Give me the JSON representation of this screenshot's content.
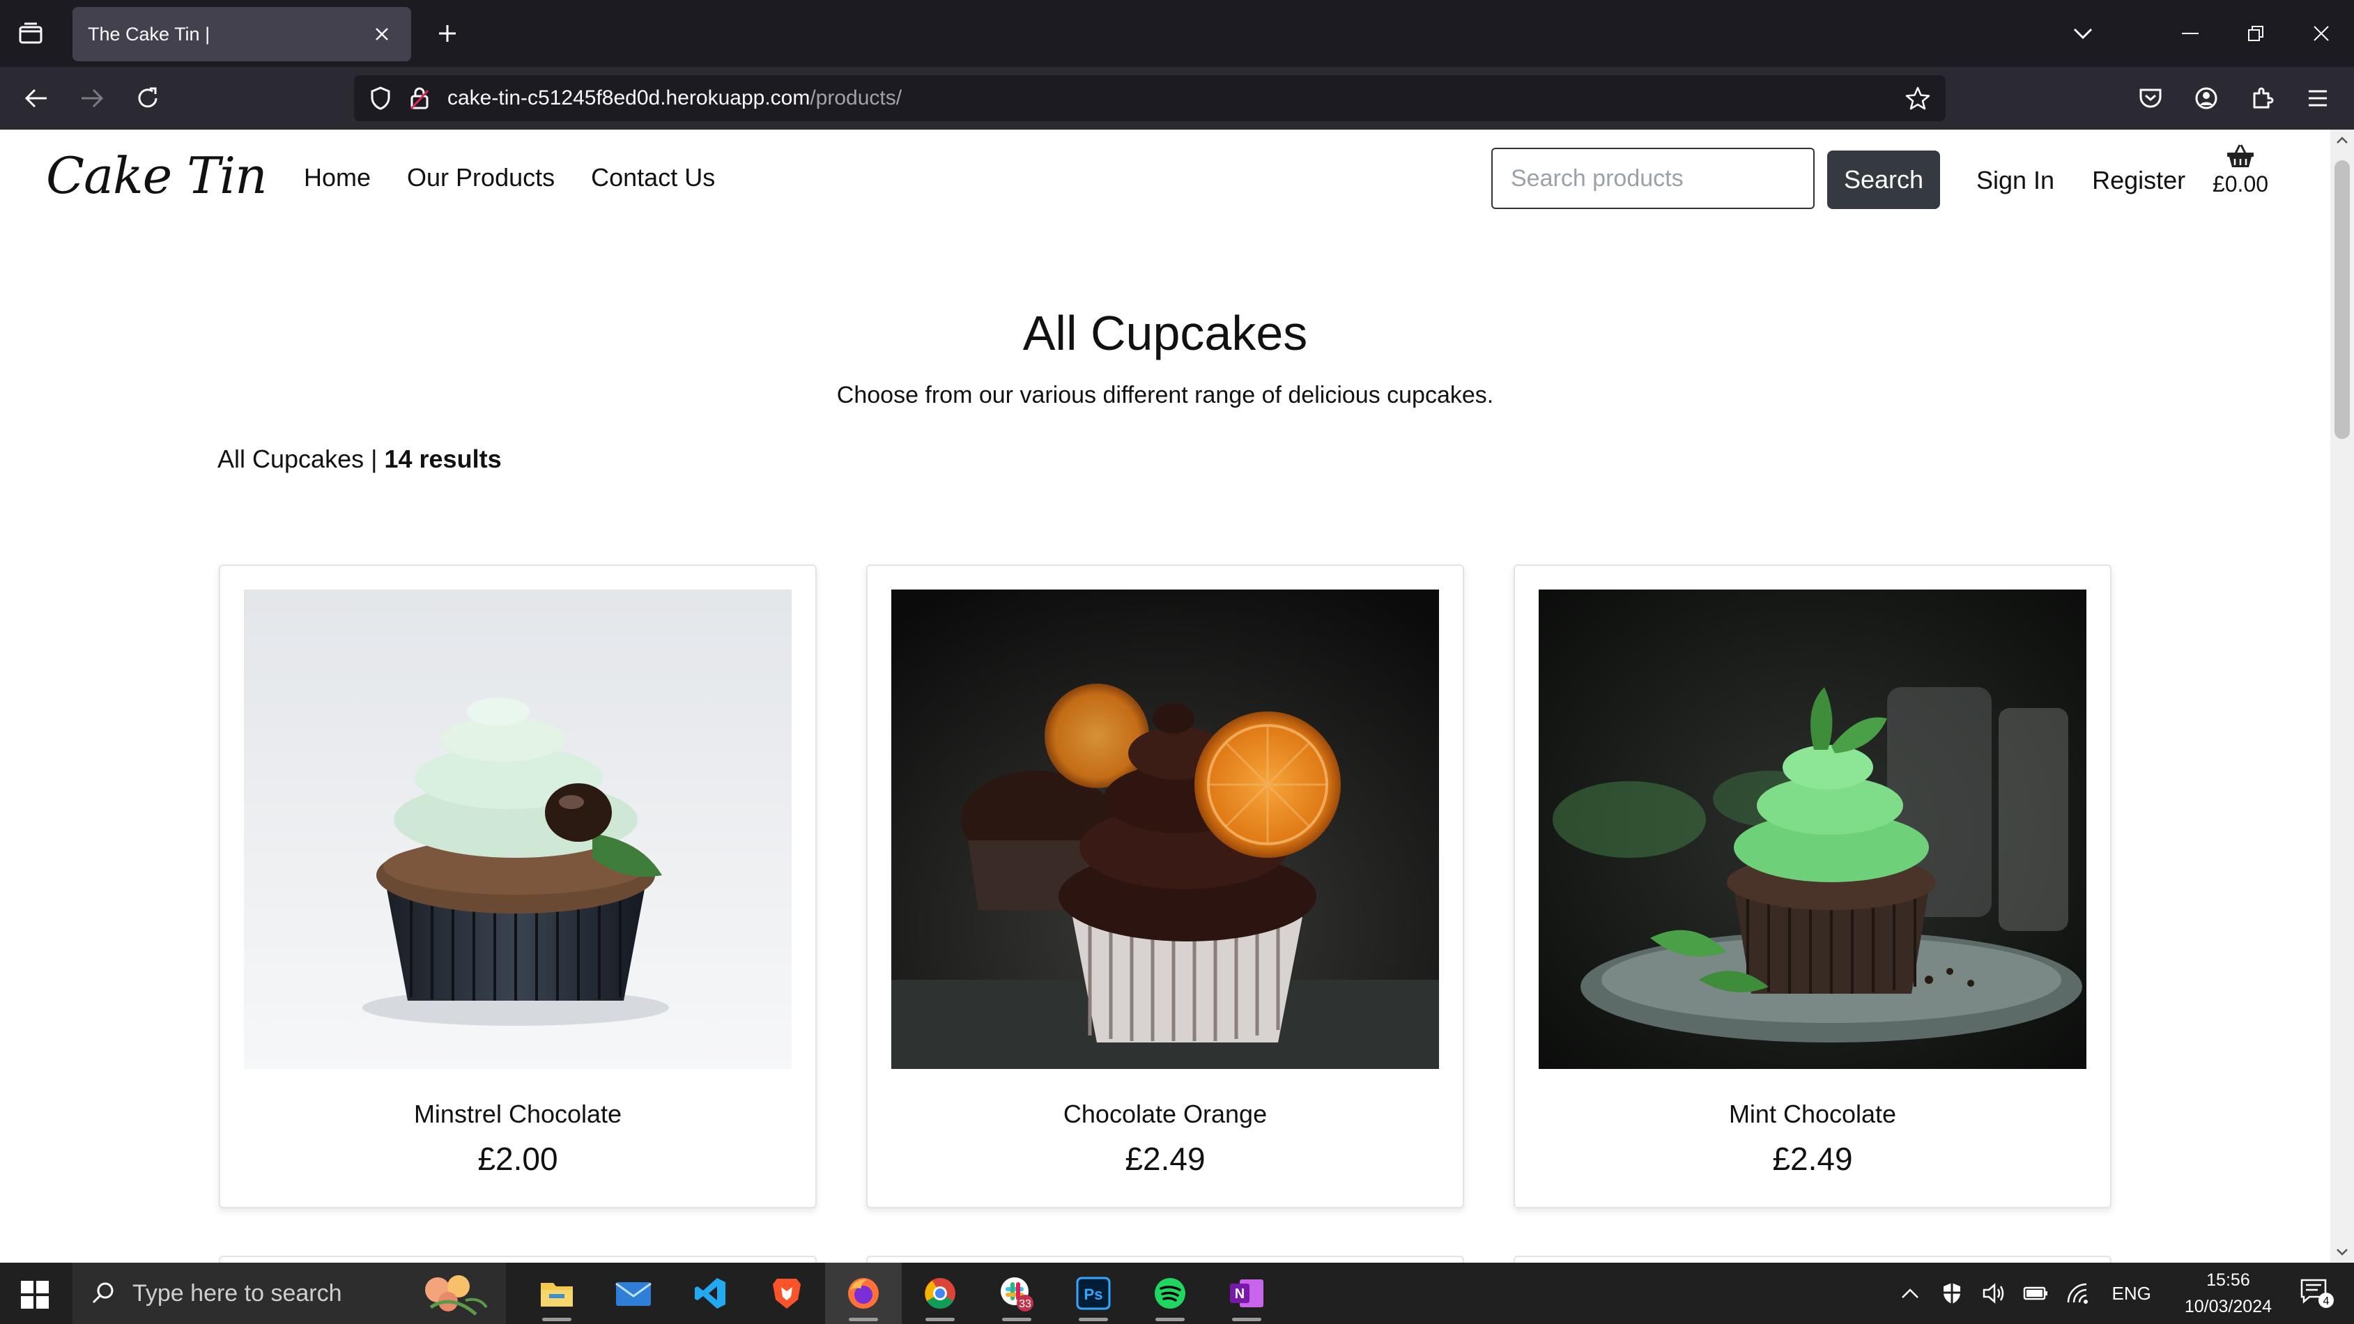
{
  "browser": {
    "tab_title": "The Cake Tin |",
    "url_host": "cake-tin-c51245f8ed0d.herokuapp.com",
    "url_path": "/products/"
  },
  "site": {
    "logo": "Cake Tin",
    "nav": [
      "Home",
      "Our Products",
      "Contact Us"
    ],
    "search_placeholder": "Search products",
    "search_button": "Search",
    "sign_in": "Sign In",
    "register": "Register",
    "basket_total": "£0.00"
  },
  "page": {
    "title": "All Cupcakes",
    "subtitle": "Choose from our various different range of delicious cupcakes.",
    "category": "All Cupcakes",
    "separator": "|",
    "results_count": "14 results"
  },
  "products": [
    {
      "name": "Minstrel Chocolate",
      "price": "£2.00"
    },
    {
      "name": "Chocolate Orange",
      "price": "£2.49"
    },
    {
      "name": "Mint Chocolate",
      "price": "£2.49"
    }
  ],
  "taskbar": {
    "search_placeholder": "Type here to search",
    "chat_badge": "33",
    "language": "ENG",
    "time": "15:56",
    "date": "10/03/2024",
    "notifications": "4"
  },
  "colors": {
    "chrome_dark": "#1c1b22",
    "toolbar": "#2b2a33",
    "search_button": "#343a40",
    "taskbar": "#202020"
  }
}
